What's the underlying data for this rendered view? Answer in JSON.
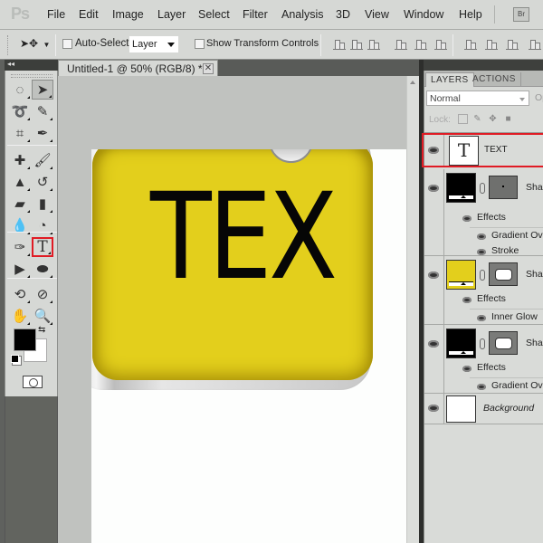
{
  "app": {
    "logo": "Ps",
    "menu": [
      "File",
      "Edit",
      "Image",
      "Layer",
      "Select",
      "Filter",
      "Analysis",
      "3D",
      "View",
      "Window",
      "Help"
    ],
    "bridge_button": "Br"
  },
  "options_bar": {
    "tool_preset_icon": "move-tool-icon",
    "auto_select_label": "Auto-Select:",
    "auto_select_checked": false,
    "auto_select_value": "Layer",
    "show_transform_label": "Show Transform Controls",
    "show_transform_checked": false,
    "align_icons": [
      "align-top-icon",
      "align-vertical-center-icon",
      "align-bottom-icon",
      "align-left-icon",
      "align-horizontal-center-icon",
      "align-right-icon"
    ],
    "distribute_icons": [
      "distribute-top-icon",
      "distribute-vertical-center-icon",
      "distribute-bottom-icon",
      "distribute-left-icon"
    ]
  },
  "toolbox": {
    "collapse_glyph": "◂◂",
    "tools": [
      {
        "name": "marquee-tool",
        "glyph": "◌"
      },
      {
        "name": "move-tool",
        "glyph": "➤",
        "selected": true
      },
      {
        "name": "lasso-tool",
        "glyph": "➰"
      },
      {
        "name": "quick-selection-tool",
        "glyph": "✎"
      },
      {
        "name": "crop-tool",
        "glyph": "⌗"
      },
      {
        "name": "eyedropper-tool",
        "glyph": "✒"
      },
      {
        "name": "healing-brush-tool",
        "glyph": "✚"
      },
      {
        "name": "brush-tool",
        "glyph": "🖌"
      },
      {
        "name": "clone-stamp-tool",
        "glyph": "▲"
      },
      {
        "name": "history-brush-tool",
        "glyph": "↺"
      },
      {
        "name": "eraser-tool",
        "glyph": "▰"
      },
      {
        "name": "gradient-tool",
        "glyph": "▮"
      },
      {
        "name": "blur-tool",
        "glyph": "💧"
      },
      {
        "name": "dodge-tool",
        "glyph": "◔"
      },
      {
        "name": "pen-tool",
        "glyph": "✑"
      },
      {
        "name": "type-tool",
        "glyph": "T",
        "highlighted": true
      },
      {
        "name": "path-selection-tool",
        "glyph": "▶"
      },
      {
        "name": "ellipse-shape-tool",
        "glyph": "⬬"
      },
      {
        "name": "3d-rotate-tool",
        "glyph": "⟲"
      },
      {
        "name": "3d-orbit-tool",
        "glyph": "⊘"
      },
      {
        "name": "hand-tool",
        "glyph": "✋"
      },
      {
        "name": "zoom-tool",
        "glyph": "🔍"
      }
    ],
    "foreground_color": "#000000",
    "background_color": "#ffffff"
  },
  "document": {
    "tab_title": "Untitled-1 @ 50% (RGB/8) *",
    "close_glyph": "✕",
    "artwork_text": "TEX",
    "plate_color": "#e3cf1c"
  },
  "layers_panel": {
    "tabs": [
      "LAYERS",
      "ACTIONS"
    ],
    "active_tab": "LAYERS",
    "blend_mode": "Normal",
    "opacity_label": "Op",
    "lock_label": "Lock:",
    "layers": [
      {
        "name": "TEXT",
        "type": "text",
        "visible": true,
        "highlighted": true
      },
      {
        "name": "Shap",
        "type": "shape",
        "fill": "#000000",
        "visible": true,
        "effects": [
          "Gradient Ov",
          "Stroke"
        ]
      },
      {
        "name": "Shap",
        "type": "shape",
        "fill": "#e3cf1c",
        "visible": true,
        "effects": [
          "Inner Glow"
        ]
      },
      {
        "name": "Shap",
        "type": "shape",
        "fill": "#000000",
        "visible": true,
        "effects": [
          "Gradient Ov"
        ]
      },
      {
        "name": "Background",
        "type": "background",
        "fill": "#ffffff",
        "visible": true
      }
    ],
    "effects_label": "Effects"
  },
  "colors": {
    "highlight": "#e01b24",
    "ui_gray": "#d6d8d5",
    "pasteboard": "#c0c2bf"
  }
}
